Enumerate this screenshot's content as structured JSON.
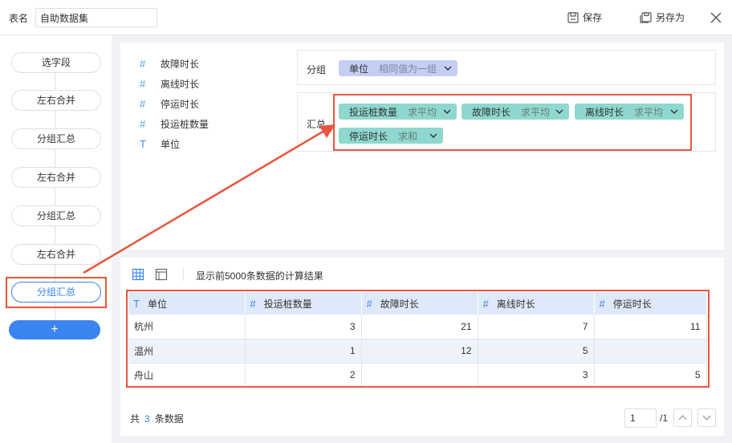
{
  "topbar": {
    "table_label": "表名",
    "table_name": "自助数据集",
    "save_label": "保存",
    "save_as_label": "另存为"
  },
  "steps": [
    {
      "label": "选字段"
    },
    {
      "label": "左右合并"
    },
    {
      "label": "分组汇总"
    },
    {
      "label": "左右合并"
    },
    {
      "label": "分组汇总"
    },
    {
      "label": "左右合并"
    },
    {
      "label": "分组汇总"
    }
  ],
  "add_label": "+",
  "fields": [
    {
      "type_icon": "#",
      "name": "故障时长"
    },
    {
      "type_icon": "#",
      "name": "离线时长"
    },
    {
      "type_icon": "#",
      "name": "停运时长"
    },
    {
      "type_icon": "#",
      "name": "投运桩数量"
    },
    {
      "type_icon": "T",
      "name": "单位"
    }
  ],
  "group": {
    "label": "分组",
    "chip": {
      "name": "单位",
      "agg": "相同值为一组"
    }
  },
  "summary": {
    "label": "汇总",
    "chips": [
      {
        "name": "投运桩数量",
        "agg": "求平均"
      },
      {
        "name": "故障时长",
        "agg": "求平均"
      },
      {
        "name": "离线时长",
        "agg": "求平均"
      },
      {
        "name": "停运时长",
        "agg": "求和"
      }
    ]
  },
  "preview": {
    "info": "显示前5000条数据的计算结果",
    "columns": [
      {
        "type_icon": "T",
        "name": "单位"
      },
      {
        "type_icon": "#",
        "name": "投运桩数量"
      },
      {
        "type_icon": "#",
        "name": "故障时长"
      },
      {
        "type_icon": "#",
        "name": "离线时长"
      },
      {
        "type_icon": "#",
        "name": "停运时长"
      }
    ],
    "rows": [
      [
        "杭州",
        "3",
        "21",
        "7",
        "11"
      ],
      [
        "温州",
        "1",
        "12",
        "5",
        ""
      ],
      [
        "舟山",
        "2",
        "",
        "3",
        "5"
      ]
    ],
    "count_prefix": "共",
    "count": "3",
    "count_suffix": "条数据",
    "page": "1",
    "page_total": "/1"
  },
  "colors": {
    "accent": "#3a85f0",
    "highlight": "#e8553e",
    "dimension_chip": "#c4cdf2",
    "measure_chip": "#8ed8cf"
  }
}
